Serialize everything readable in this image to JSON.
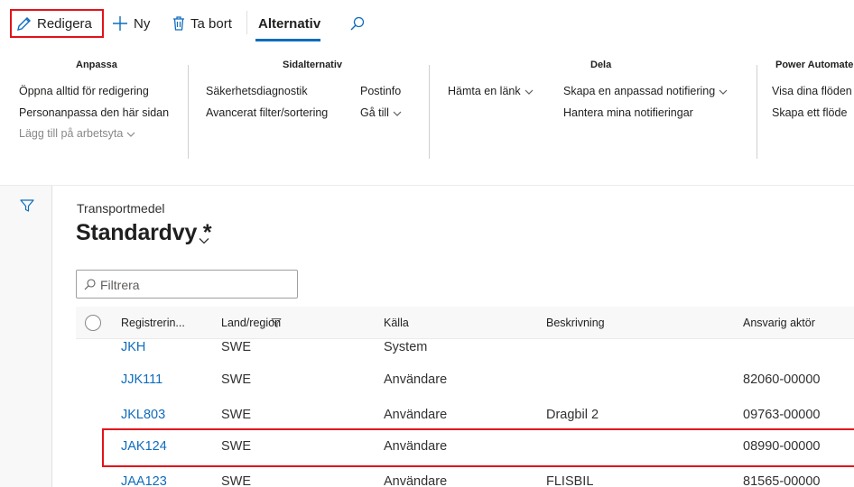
{
  "toolbar": {
    "edit_label": "Redigera",
    "new_label": "Ny",
    "delete_label": "Ta bort",
    "options_tab_label": "Alternativ"
  },
  "ribbon": {
    "groups": [
      {
        "title": "Anpassa",
        "items": [
          "Öppna alltid för redigering",
          "Personanpassa den här sidan",
          "Lägg till på arbetsyta"
        ]
      },
      {
        "title": "Sidalternativ",
        "items": [
          "Säkerhetsdiagnostik",
          "Avancerat filter/sortering",
          "Postinfo",
          "Gå till"
        ]
      },
      {
        "title": "Dela",
        "items": [
          "Hämta en länk",
          "Skapa en anpassad notifiering",
          "Hantera mina notifieringar"
        ]
      },
      {
        "title": "Power Automate",
        "items": [
          "Visa dina flöden",
          "Skapa ett flöde"
        ]
      }
    ]
  },
  "page": {
    "caption": "Transportmedel",
    "view_name": "Standardvy *",
    "filter_placeholder": "Filtrera"
  },
  "grid": {
    "columns": [
      "Registrerin...",
      "Land/region",
      "Källa",
      "Beskrivning",
      "Ansvarig aktör"
    ],
    "rows": [
      {
        "reg": "JKH",
        "country": "SWE",
        "source": "System",
        "description": "",
        "actor": ""
      },
      {
        "reg": "JJK111",
        "country": "SWE",
        "source": "Användare",
        "description": "",
        "actor": "82060-00000"
      },
      {
        "reg": "JKL803",
        "country": "SWE",
        "source": "Användare",
        "description": "Dragbil 2",
        "actor": "09763-00000"
      },
      {
        "reg": "JAK124",
        "country": "SWE",
        "source": "Användare",
        "description": "",
        "actor": "08990-00000"
      },
      {
        "reg": "JAA123",
        "country": "SWE",
        "source": "Användare",
        "description": "FLISBIL",
        "actor": "81565-00000"
      }
    ]
  },
  "colors": {
    "accent": "#0f6cbd",
    "highlight": "#e3121b"
  },
  "icons": [
    "edit-pencil-icon",
    "plus-icon",
    "trash-icon",
    "search-icon",
    "chevron-down-icon",
    "funnel-icon"
  ]
}
